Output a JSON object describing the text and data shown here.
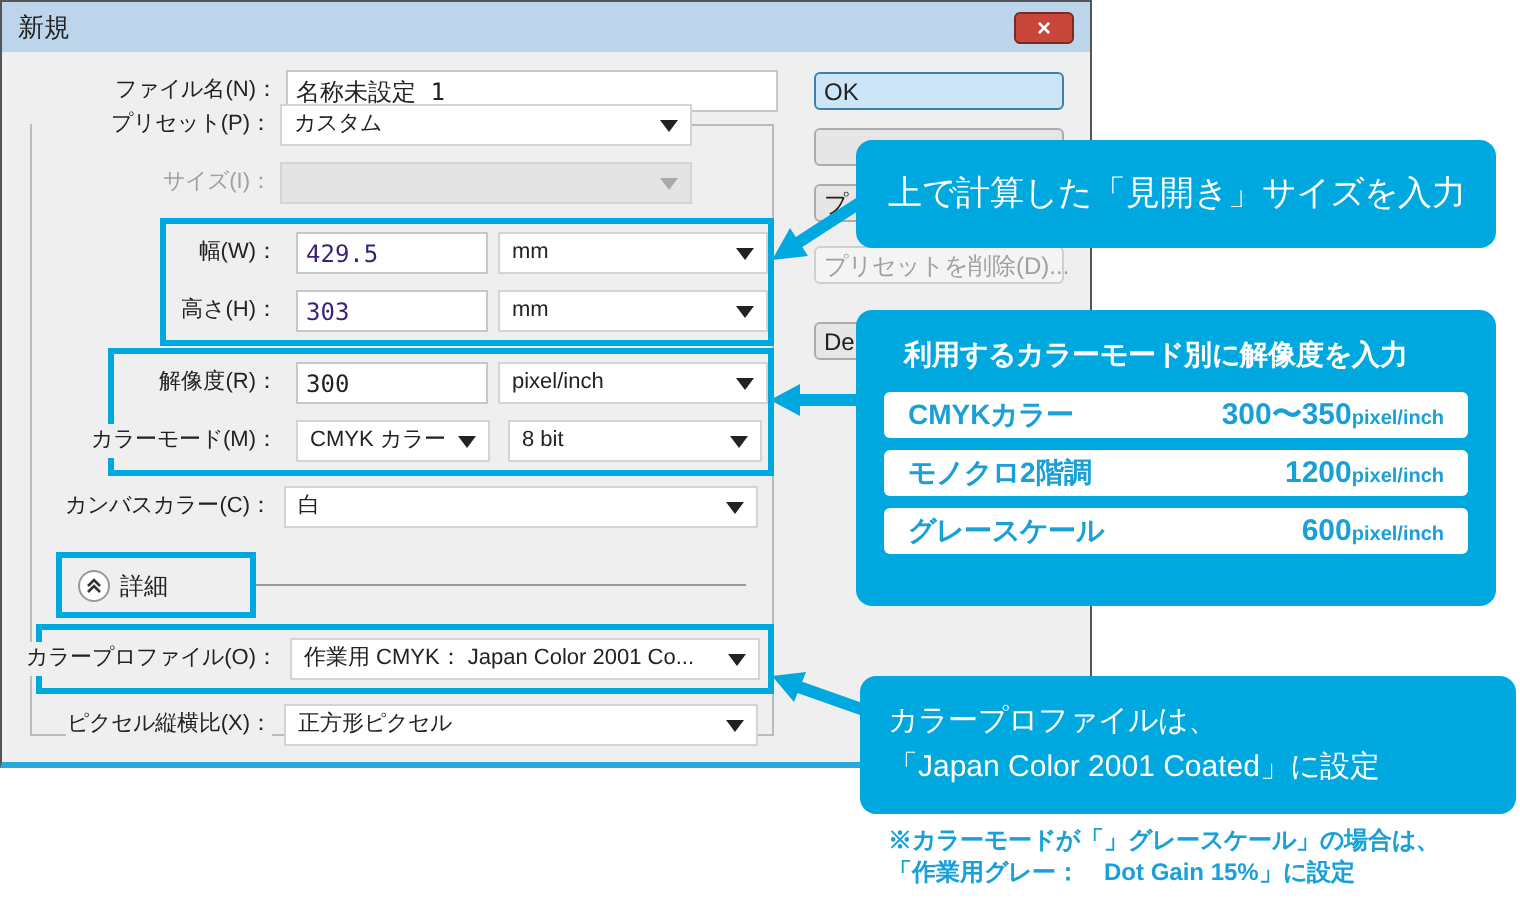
{
  "window": {
    "title": "新規",
    "close": "×"
  },
  "file_name": {
    "label": "ファイル名(N)：",
    "value": "名称未設定 1"
  },
  "preset": {
    "label": "プリセット(P)：",
    "value": "カスタム"
  },
  "size": {
    "label": "サイズ(I)：",
    "disabled": true
  },
  "highlight_groups": [
    {
      "rows": [
        {
          "label": "幅(W)：",
          "value": "429.5",
          "unit": "mm"
        },
        {
          "label": "高さ(H)：",
          "value": "303",
          "unit": "mm"
        }
      ]
    },
    {
      "rows": [
        {
          "label": "解像度(R)：",
          "value": "300",
          "unit": "pixel/inch",
          "kind": "input"
        },
        {
          "label": "カラーモード(M)：",
          "value": "CMYK カラー",
          "unit": "8 bit",
          "kind": "select"
        }
      ]
    }
  ],
  "canvas_color": {
    "label": "カンバスカラー(C)：",
    "value": "白"
  },
  "advanced": {
    "label": "詳細",
    "expanded": true
  },
  "color_profile": {
    "label": "カラープロファイル(O)：",
    "value": "作業用 CMYK： Japan Color 2001 Co..."
  },
  "pixel_aspect": {
    "label": "ピクセル縦横比(X)：",
    "value": "正方形ピクセル"
  },
  "buttons": [
    {
      "label": "OK",
      "default": true,
      "disabled": false
    },
    {
      "default": false,
      "disabled": false
    },
    {
      "label": "プ",
      "default": false,
      "disabled": false
    },
    {
      "label": "プリセットを削除(D)...",
      "default": false,
      "disabled": true
    },
    {
      "label": "De",
      "default": false,
      "disabled": false
    }
  ],
  "callouts": [
    {
      "text": "上で計算した「見開き」サイズを入力"
    },
    {
      "title": "利用するカラーモード別に解像度を入力",
      "items": [
        {
          "mode": "CMYKカラー",
          "value": "300〜350",
          "unit": "pixel/inch"
        },
        {
          "mode": "モノクロ2階調",
          "value": "1200",
          "unit": "pixel/inch"
        },
        {
          "mode": "グレースケール",
          "value": "600",
          "unit": "pixel/inch"
        }
      ]
    },
    {
      "lines": [
        "カラープロファイルは、",
        "「Japan Color 2001 Coated」に設定"
      ]
    }
  ],
  "note": [
    "※カラーモードが「」グレースケール」の場合は、",
    "「作業用グレー：　Dot Gain 15%」に設定"
  ]
}
